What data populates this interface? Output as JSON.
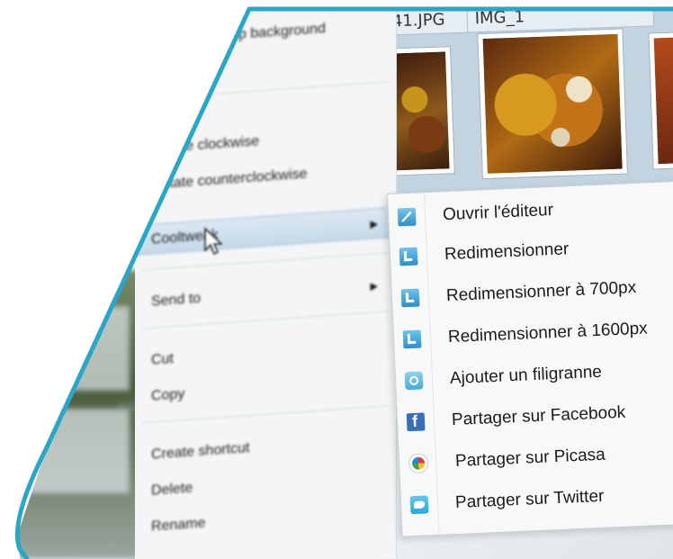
{
  "thumbnails": {
    "label_1": "41.JPG",
    "label_2": "IMG_1"
  },
  "explorer": {
    "tile_label": "IMG_"
  },
  "context_menu": {
    "items": [
      {
        "label": "Set as desktop background"
      },
      {
        "label": "Rotate clockwise"
      },
      {
        "label": "Rotate counterclockwise"
      },
      {
        "label": "Cooltweak"
      },
      {
        "label": "Send to"
      },
      {
        "label": "Cut"
      },
      {
        "label": "Copy"
      },
      {
        "label": "Create shortcut"
      },
      {
        "label": "Delete"
      },
      {
        "label": "Rename"
      }
    ],
    "arrow_glyph": "▶"
  },
  "submenu": {
    "items": [
      {
        "label": "Ouvrir l'éditeur",
        "icon": "editor-icon"
      },
      {
        "label": "Redimensionner",
        "icon": "resize-icon"
      },
      {
        "label": "Redimensionner à 700px",
        "icon": "resize-icon"
      },
      {
        "label": "Redimensionner à 1600px",
        "icon": "resize-icon"
      },
      {
        "label": "Ajouter un filigranne",
        "icon": "watermark-icon"
      },
      {
        "label": "Partager sur Facebook",
        "icon": "facebook-icon"
      },
      {
        "label": "Partager sur Picasa",
        "icon": "picasa-icon"
      },
      {
        "label": "Partager sur Twitter",
        "icon": "twitter-icon"
      }
    ]
  },
  "colors": {
    "accent": "#2aa7c8",
    "highlight": "#c5d9ea",
    "facebook": "#3a6fb6",
    "twitter": "#2aa6dd"
  }
}
